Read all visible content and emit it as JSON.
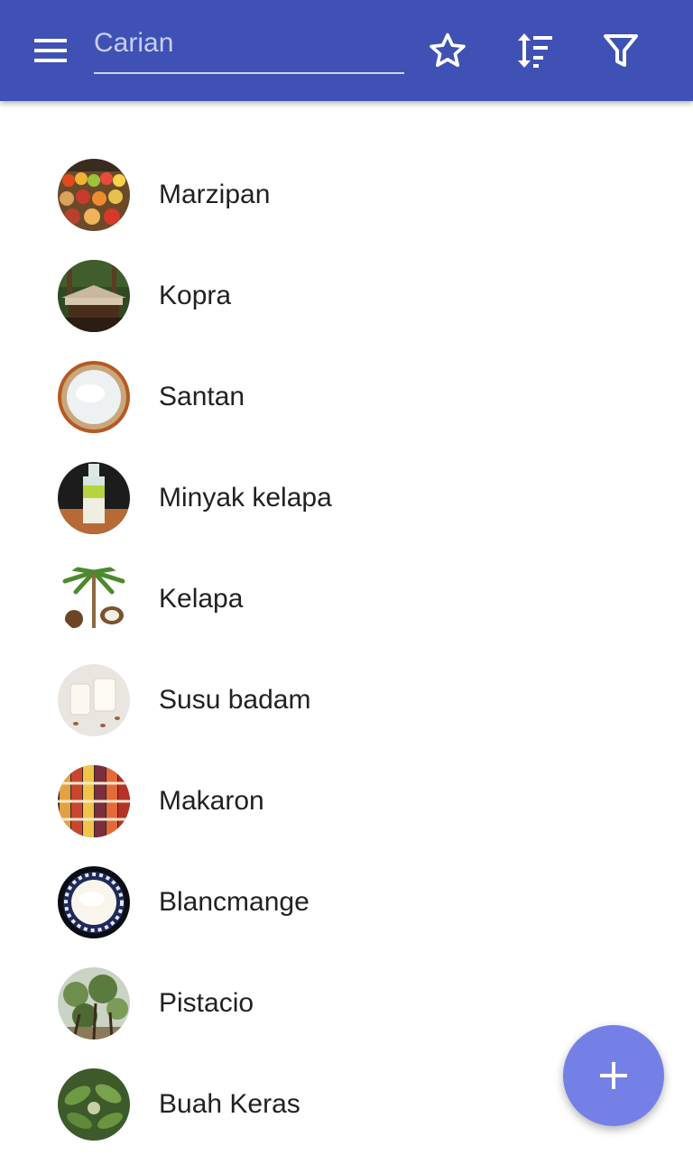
{
  "appbar": {
    "background": "#3F51B5",
    "menu_icon": "menu-icon",
    "search_placeholder": "Carian",
    "search_value": "",
    "actions": [
      {
        "icon": "star-outline-icon"
      },
      {
        "icon": "sort-icon"
      },
      {
        "icon": "filter-icon"
      }
    ]
  },
  "list": {
    "items": [
      {
        "label": "Marzipan",
        "thumb": "market-fruit-stalls"
      },
      {
        "label": "Kopra",
        "thumb": "drying-shed"
      },
      {
        "label": "Santan",
        "thumb": "bowl-of-milk"
      },
      {
        "label": "Minyak kelapa",
        "thumb": "oil-jar"
      },
      {
        "label": "Kelapa",
        "thumb": "coconut-palm"
      },
      {
        "label": "Susu badam",
        "thumb": "almond-milk-glasses"
      },
      {
        "label": "Makaron",
        "thumb": "macarons"
      },
      {
        "label": "Blancmange",
        "thumb": "pudding-bowl"
      },
      {
        "label": "Pistacio",
        "thumb": "pistachio-tree"
      },
      {
        "label": "Buah Keras",
        "thumb": "nut-leaves"
      }
    ]
  },
  "fab": {
    "icon": "plus-icon",
    "color": "#7480E6"
  }
}
